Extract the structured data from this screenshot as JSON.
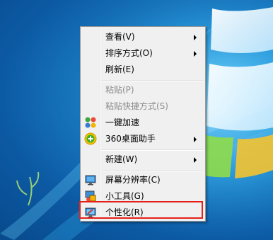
{
  "context_menu": {
    "items": [
      {
        "label": "查看(V)",
        "submenu": true,
        "disabled": false
      },
      {
        "label": "排序方式(O)",
        "submenu": true,
        "disabled": false
      },
      {
        "label": "刷新(E)",
        "submenu": false,
        "disabled": false
      },
      {
        "label": "粘贴(P)",
        "submenu": false,
        "disabled": true
      },
      {
        "label": "粘贴快捷方式(S)",
        "submenu": false,
        "disabled": true
      },
      {
        "label": "一键加速",
        "submenu": false,
        "disabled": false,
        "icon": "speedup-icon"
      },
      {
        "label": "360桌面助手",
        "submenu": true,
        "disabled": false,
        "icon": "360-desktop-icon"
      },
      {
        "label": "新建(W)",
        "submenu": true,
        "disabled": false
      },
      {
        "label": "屏幕分辨率(C)",
        "submenu": false,
        "disabled": false,
        "icon": "monitor-icon"
      },
      {
        "label": "小工具(G)",
        "submenu": false,
        "disabled": false,
        "icon": "gadgets-icon"
      },
      {
        "label": "个性化(R)",
        "submenu": false,
        "disabled": false,
        "icon": "personalize-icon",
        "highlighted": true
      }
    ]
  },
  "colors": {
    "highlight_border": "#e5201a",
    "desktop_blue": "#1e86cc"
  }
}
